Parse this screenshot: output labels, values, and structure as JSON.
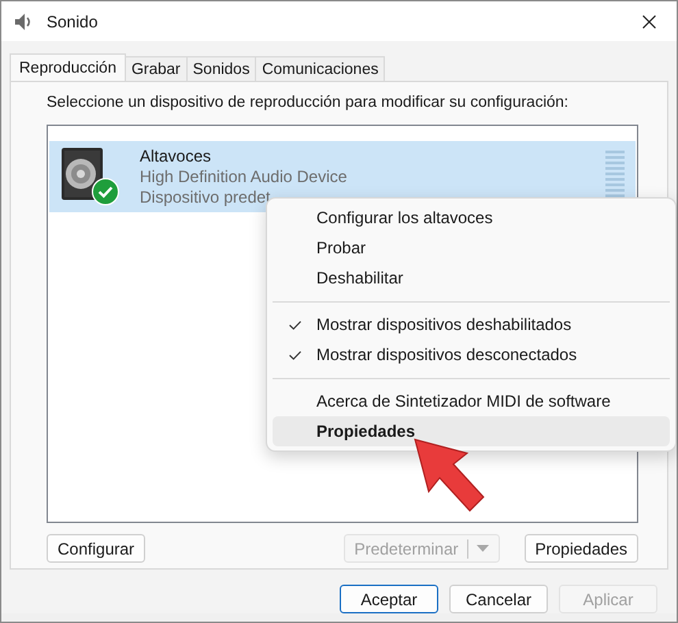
{
  "window": {
    "title": "Sonido"
  },
  "tabs": [
    {
      "label": "Reproducción",
      "selected": true
    },
    {
      "label": "Grabar",
      "selected": false
    },
    {
      "label": "Sonidos",
      "selected": false
    },
    {
      "label": "Comunicaciones",
      "selected": false
    }
  ],
  "instruction": "Seleccione un dispositivo de reproducción para modificar su configuración:",
  "devices": [
    {
      "name": "Altavoces",
      "description": "High Definition Audio Device",
      "status": "Dispositivo predet",
      "selected": true,
      "default": true
    }
  ],
  "context_menu": [
    {
      "kind": "item",
      "label": "Configurar los altavoces",
      "checked": false,
      "selected": false
    },
    {
      "kind": "item",
      "label": "Probar",
      "checked": false,
      "selected": false
    },
    {
      "kind": "item",
      "label": "Deshabilitar",
      "checked": false,
      "selected": false
    },
    {
      "kind": "separator"
    },
    {
      "kind": "item",
      "label": "Mostrar dispositivos deshabilitados",
      "checked": true,
      "selected": false
    },
    {
      "kind": "item",
      "label": "Mostrar dispositivos desconectados",
      "checked": true,
      "selected": false
    },
    {
      "kind": "separator"
    },
    {
      "kind": "item",
      "label": "Acerca de Sintetizador MIDI de software",
      "checked": false,
      "selected": false
    },
    {
      "kind": "item",
      "label": "Propiedades",
      "checked": false,
      "selected": true
    }
  ],
  "panel_buttons": [
    {
      "kind": "plain",
      "label": "Configurar",
      "disabled": false
    },
    {
      "kind": "split",
      "label": "Predeterminar",
      "disabled": true
    },
    {
      "kind": "plain",
      "label": "Propiedades",
      "disabled": false
    }
  ],
  "dialog_buttons": [
    {
      "label": "Aceptar",
      "default": true,
      "disabled": false
    },
    {
      "label": "Cancelar",
      "default": false,
      "disabled": false
    },
    {
      "label": "Aplicar",
      "default": false,
      "disabled": true
    }
  ]
}
